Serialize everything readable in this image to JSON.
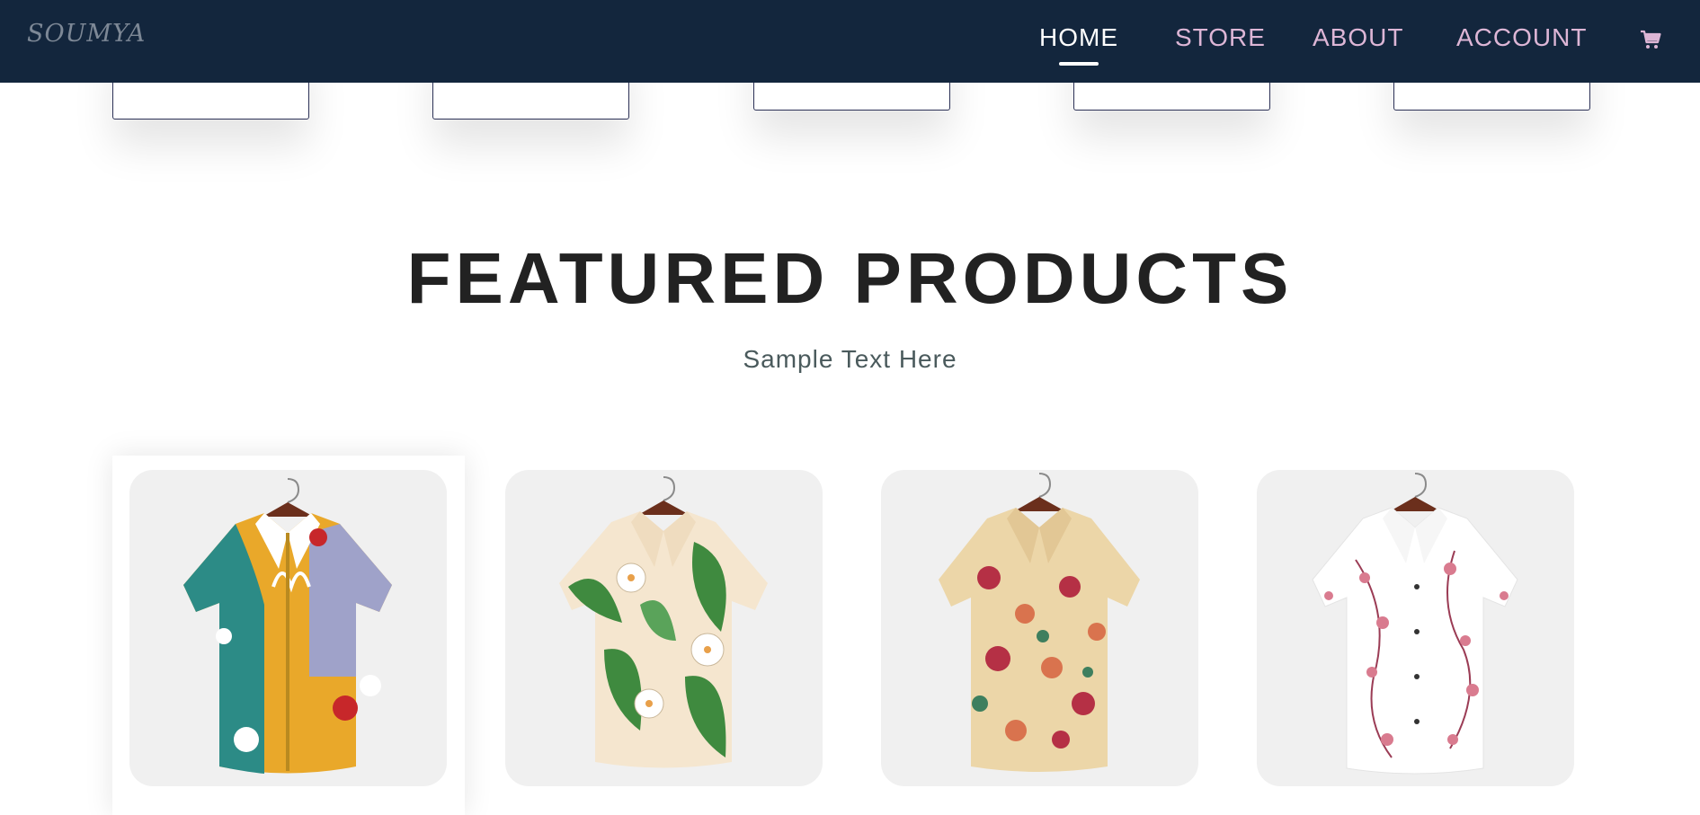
{
  "brand": {
    "logo_text": "SOUMYA"
  },
  "nav": {
    "items": [
      {
        "label": "HOME",
        "active": true
      },
      {
        "label": "STORE",
        "active": false
      },
      {
        "label": "ABOUT",
        "active": false
      },
      {
        "label": "ACCOUNT",
        "active": false
      }
    ],
    "cart_icon": "shopping-cart-icon"
  },
  "featured": {
    "title": "FEATURED PRODUCTS",
    "subtitle": "Sample Text Here"
  },
  "products": [
    {
      "name": "abstract-print-shirt",
      "colors": [
        "#e9a82a",
        "#2c8b86",
        "#9fa2c9",
        "#c7272a",
        "#ffffff"
      ]
    },
    {
      "name": "tropical-leaf-shirt",
      "colors": [
        "#f5e6cf",
        "#3f8a3f",
        "#ffffff",
        "#e8a04a"
      ]
    },
    {
      "name": "floral-rose-shirt",
      "colors": [
        "#ecd6a8",
        "#b53045",
        "#d9734e",
        "#3e7f5e"
      ]
    },
    {
      "name": "pink-blossom-shirt",
      "colors": [
        "#ffffff",
        "#d97b8f",
        "#9b3c55"
      ]
    }
  ],
  "theme": {
    "navbar_bg": "#13263d",
    "nav_text": "#ddb6d6",
    "nav_active": "#ffffff",
    "heading": "#222222",
    "card_bg": "#f0f0f0"
  }
}
